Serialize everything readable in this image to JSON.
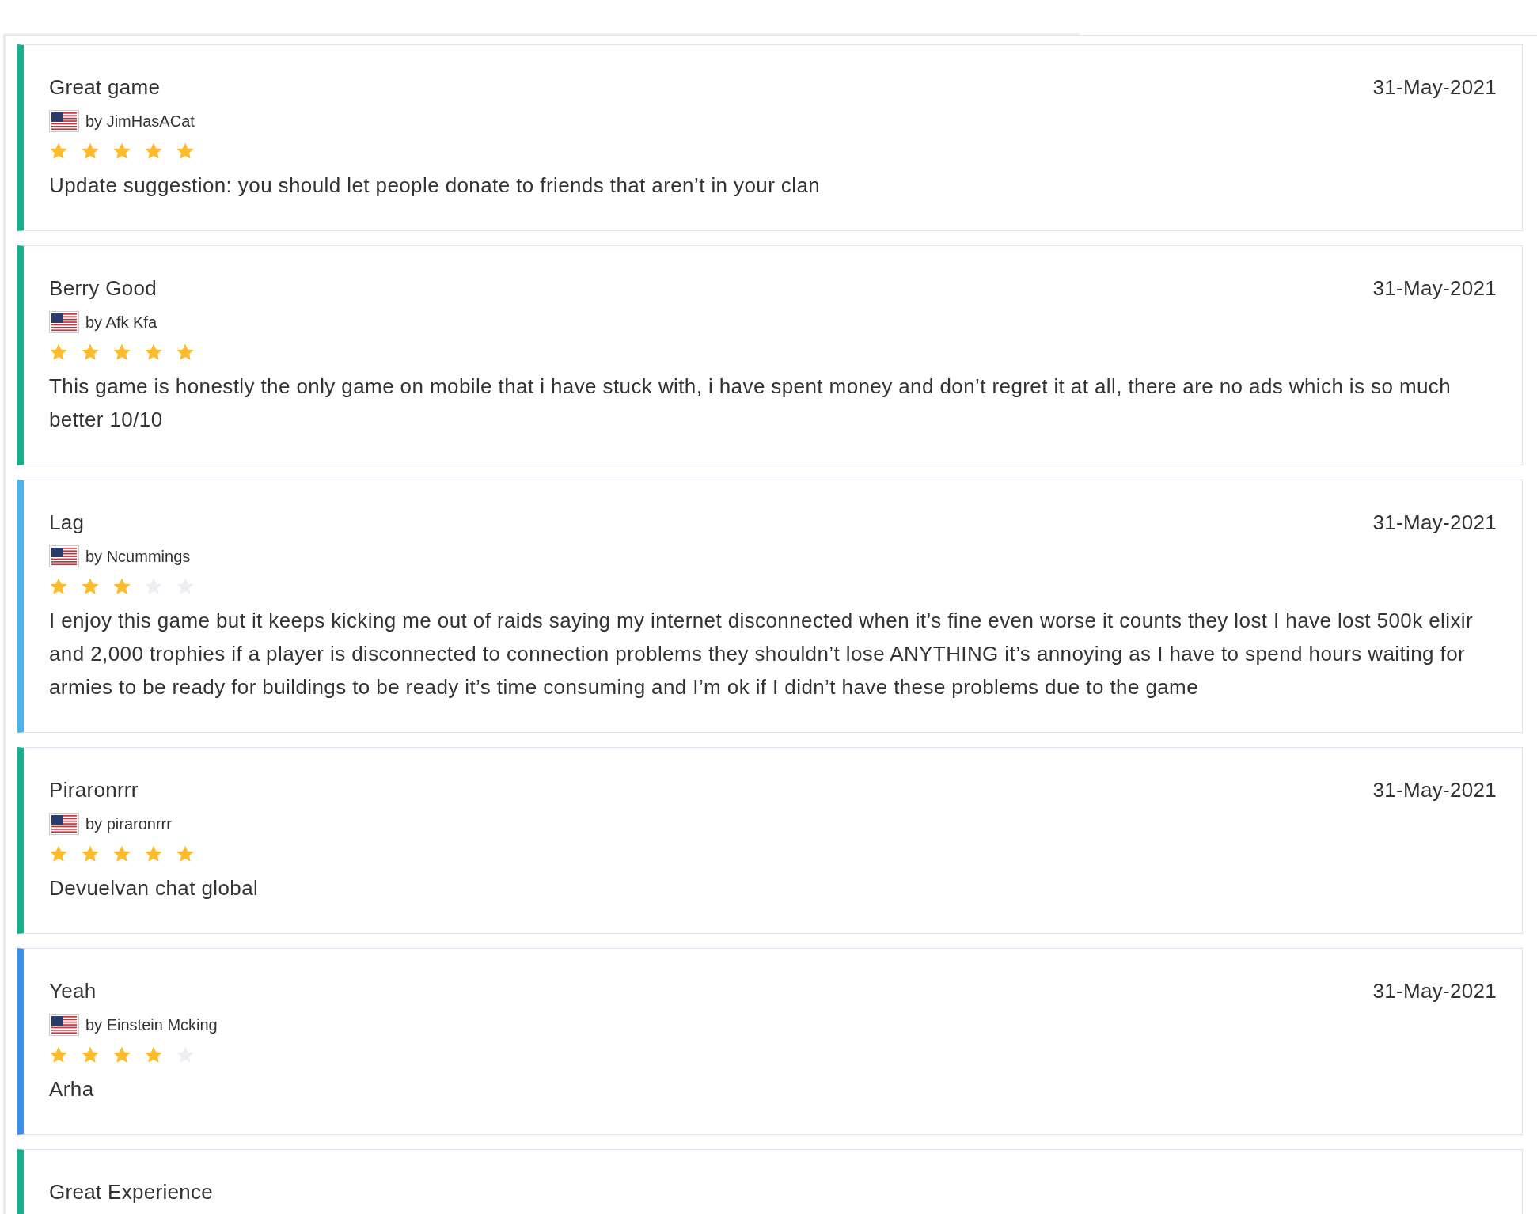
{
  "reviews": [
    {
      "title": "Great game",
      "date": "31-May-2021",
      "author": "by JimHasACat",
      "stars": 5,
      "color": "#17b08f",
      "body": "Update suggestion: you should let people donate to friends that aren’t in your clan"
    },
    {
      "title": "Berry Good",
      "date": "31-May-2021",
      "author": "by Afk Kfa",
      "stars": 5,
      "color": "#17b08f",
      "body": "This game is honestly the only game on mobile that i have stuck with, i have spent money and don’t regret it at all, there are no ads which is so much better 10/10"
    },
    {
      "title": "Lag",
      "date": "31-May-2021",
      "author": "by Ncummings",
      "stars": 3,
      "color": "#4ab4ea",
      "body": "I enjoy this game but it keeps kicking me out of raids saying my internet disconnected when it’s fine even worse it counts they lost I have lost 500k elixir and 2,000 trophies if a player is disconnected to connection problems they shouldn’t lose ANYTHING it’s annoying as I have to spend hours waiting for armies to be ready for buildings to be ready it’s time consuming and I’m ok if I didn’t have these problems due to the game"
    },
    {
      "title": "Piraronrrr",
      "date": "31-May-2021",
      "author": "by piraronrrr",
      "stars": 5,
      "color": "#17b08f",
      "body": "Devuelvan chat global"
    },
    {
      "title": "Yeah",
      "date": "31-May-2021",
      "author": "by Einstein Mcking",
      "stars": 4,
      "color": "#3d8ee9",
      "body": "Arha"
    },
    {
      "title": "Great Experience",
      "color": "#17b08f"
    }
  ]
}
